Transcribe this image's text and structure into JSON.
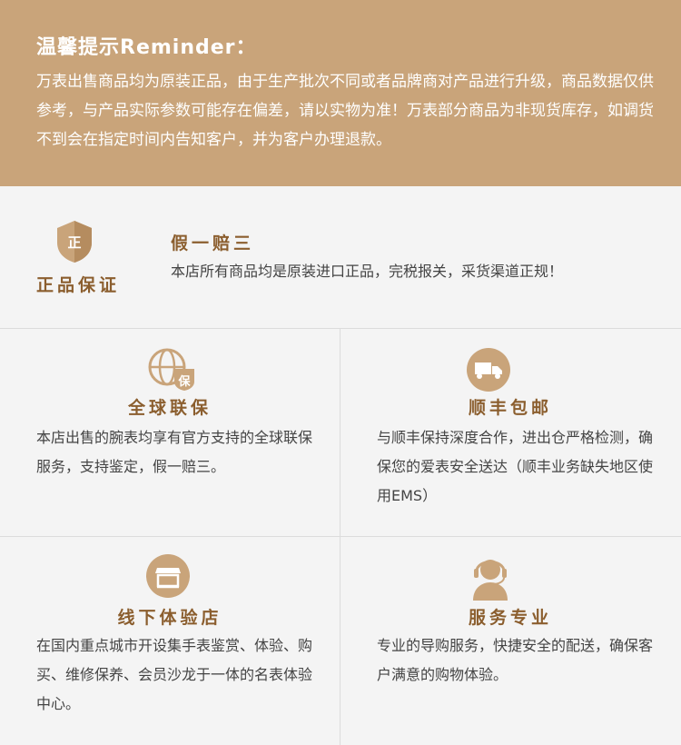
{
  "reminder": {
    "title": "温馨提示Reminder：",
    "text": "万表出售商品均为原装正品，由于生产批次不同或者品牌商对产品进行升级，商品数据仅供参考，与产品实际参数可能存在偏差，请以实物为准！万表部分商品为非现货库存，如调货不到会在指定时间内告知客户，并为客户办理退款。"
  },
  "guarantee": {
    "badge_char": "正",
    "badge_label": "正品保证",
    "headline": "假一赔三",
    "text": "本店所有商品均是原装进口正品，完税报关，采货渠道正规！"
  },
  "features": [
    {
      "icon": "globe-warranty-icon",
      "badge_char": "保",
      "title": "全球联保",
      "text": "本店出售的腕表均享有官方支持的全球联保服务，支持鉴定，假一赔三。"
    },
    {
      "icon": "delivery-truck-icon",
      "title": "顺丰包邮",
      "text": "与顺丰保持深度合作，进出仓严格检测，确保您的爱表安全送达（顺丰业务缺失地区使用EMS）"
    },
    {
      "icon": "storefront-icon",
      "title": "线下体验店",
      "text": "在国内重点城市开设集手表鉴赏、体验、购买、维修保养、会员沙龙于一体的名表体验中心。"
    },
    {
      "icon": "customer-service-icon",
      "title": "服务专业",
      "text": "专业的导购服务，快捷安全的配送，确保客户满意的购物体验。"
    }
  ],
  "colors": {
    "header_bg": "#c9a47a",
    "accent": "#8b5e2e",
    "icon_fill": "#c9a47a"
  }
}
